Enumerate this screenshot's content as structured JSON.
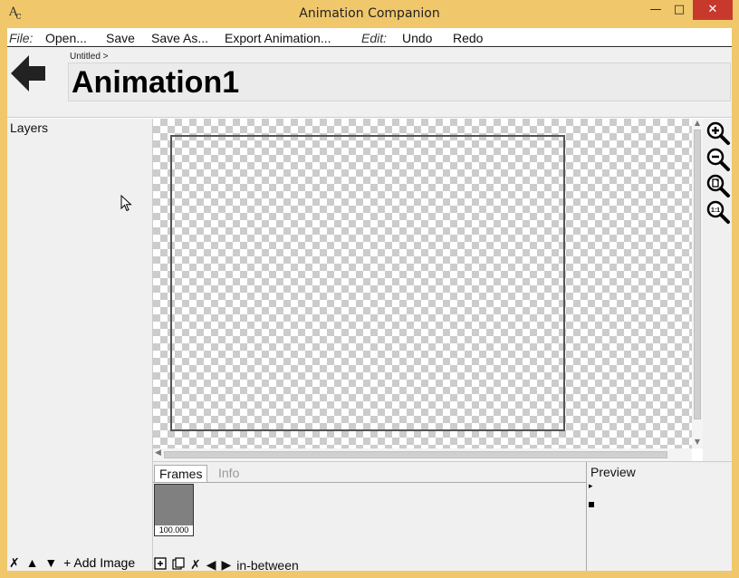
{
  "window": {
    "app_icon_main": "A",
    "app_icon_sub": "c",
    "title": "Animation Companion",
    "min_glyph": "—",
    "max_glyph": "□",
    "close_glyph": "✕"
  },
  "menubar": {
    "file_label": "File:",
    "open": "Open...",
    "save": "Save",
    "save_as": "Save As...",
    "export": "Export Animation...",
    "edit_label": "Edit:",
    "undo": "Undo",
    "redo": "Redo"
  },
  "header": {
    "back_icon": "back-arrow-icon",
    "breadcrumb": "Untitled >",
    "name": "Animation1"
  },
  "layers": {
    "title": "Layers",
    "delete_glyph": "✗",
    "up_glyph": "▲",
    "down_glyph": "▼",
    "add_image": "+ Add Image"
  },
  "zoom": {
    "icons": [
      "zoom-in-icon",
      "zoom-out-icon",
      "zoom-fit-page-icon",
      "zoom-actual-size-icon"
    ]
  },
  "frames_panel": {
    "tabs": [
      {
        "label": "Frames",
        "active": true
      },
      {
        "label": "Info",
        "active": false
      }
    ],
    "frames": [
      {
        "label": "100.000"
      }
    ],
    "delete_glyph": "✗",
    "prev_glyph": "◀",
    "next_glyph": "▶",
    "inbetween": "in-between"
  },
  "preview": {
    "title": "Preview",
    "play_glyph": "▸"
  },
  "colors": {
    "window_frame": "#f0c86b",
    "close_button": "#c7392d",
    "panel_bg": "#f0f0f0",
    "frame_thumb": "#808080",
    "checker_light": "#ffffff",
    "checker_dark": "#cccccc"
  }
}
